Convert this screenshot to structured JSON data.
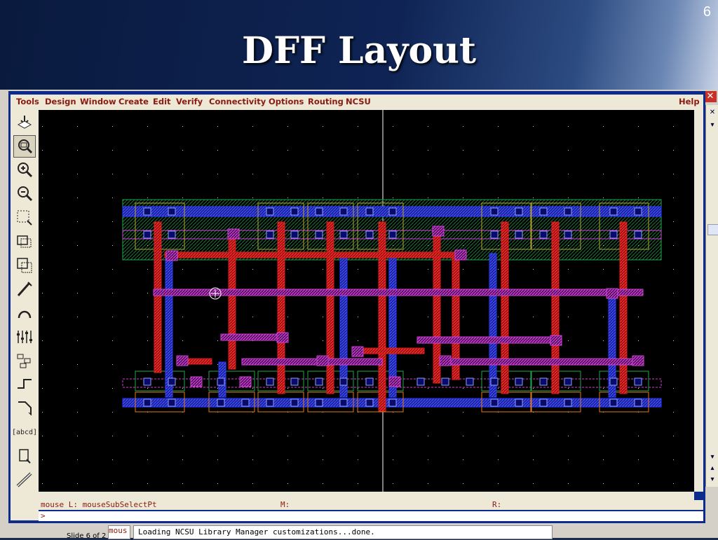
{
  "slide": {
    "title": "DFF Layout",
    "number": "6",
    "counter": "Slide 6 of 2"
  },
  "menu": [
    "Tools",
    "Design",
    "Window",
    "Create",
    "Edit",
    "Verify",
    "Connectivity",
    "Options",
    "Routing",
    "NCSU"
  ],
  "help_label": "Help",
  "toolbar": {
    "tools": [
      "save-icon",
      "fit-view-icon",
      "zoom-in-icon",
      "zoom-out-icon",
      "stretch-icon",
      "copy-icon",
      "move-icon",
      "delete-icon",
      "undo-icon",
      "properties-icon",
      "instance-icon",
      "path-icon",
      "polygon-icon",
      "label-icon",
      "rectangle-icon",
      "ruler-icon"
    ],
    "label_text": "[abcd]"
  },
  "status": {
    "mouse": "mouse L: mouseSubSelectPt",
    "m": "M:",
    "r": "R:"
  },
  "command": {
    "prompt": ">"
  },
  "ciw": {
    "tab": "mous",
    "message": "Loading NCSU Library Manager customizations...done."
  },
  "bg_window": {
    "close": "✕"
  },
  "colors": {
    "metal1": "#2a3cff",
    "poly": "#e01a1a",
    "metal2": "#d040d8",
    "active": "#1fa84a",
    "nwell_outline": "#e07a20",
    "background": "#000000"
  }
}
